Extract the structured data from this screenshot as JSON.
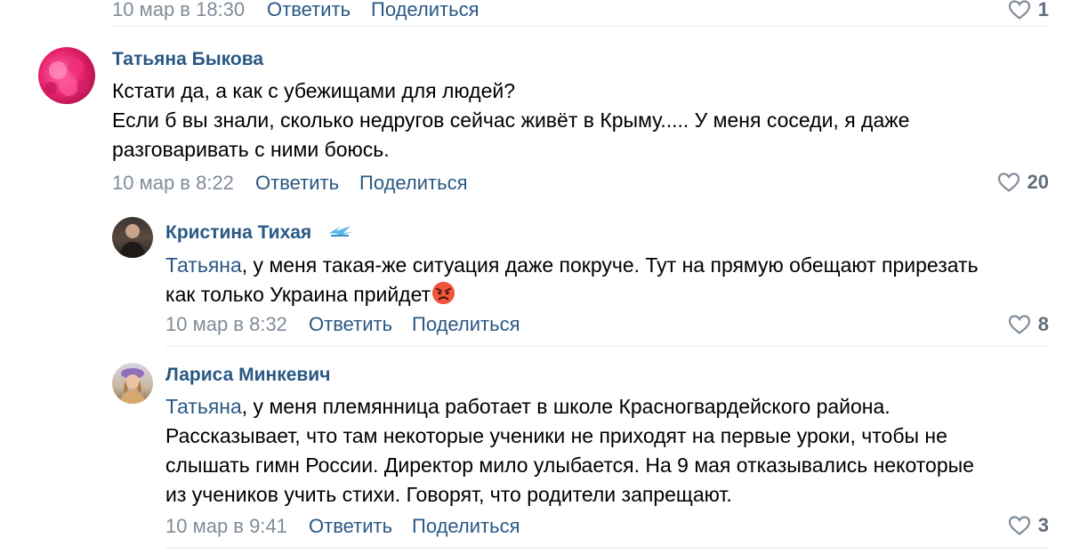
{
  "top_comment": {
    "time": "10 мар в 18:30",
    "reply": "Ответить",
    "share": "Поделиться",
    "likes": "1"
  },
  "comments": [
    {
      "author": "Татьяна Быкова",
      "lines": [
        "Кстати да, а как с убежищами для людей?",
        "Если б вы знали, сколько недругов сейчас живёт в Крыму..... У меня соседи, я даже",
        "разговаривать с ними боюсь."
      ],
      "time": "10 мар в 8:22",
      "reply": "Ответить",
      "share": "Поделиться",
      "likes": "20"
    },
    {
      "author": "Кристина Тихая",
      "badge_icon": "zenit-badge-icon",
      "mention": "Татьяна",
      "line1_rest": ", у меня такая-же ситуация даже покруче. Тут на прямую обещают прирезать",
      "line2": "как только Украина прийдет",
      "emoji": "angry-face-emoji",
      "time": "10 мар в 8:32",
      "reply": "Ответить",
      "share": "Поделиться",
      "likes": "8"
    },
    {
      "author": "Лариса Минкевич",
      "mention": "Татьяна",
      "line1_rest": ", у меня племянница работает в школе Красногвардейского района.",
      "lines": [
        "Рассказывает, что там некоторые ученики не приходят на первые уроки, чтобы не",
        "слышать гимн России. Директор мило улыбается. На 9 мая отказывались некоторые",
        "из учеников учить стихи. Говорят, что родители запрещают."
      ],
      "time": "10 мар в 9:41",
      "reply": "Ответить",
      "share": "Поделиться",
      "likes": "3"
    }
  ],
  "colors": {
    "link": "#2a5885",
    "meta": "#818c99",
    "divider": "#e7e8ec",
    "like_count": "#626d7a"
  }
}
